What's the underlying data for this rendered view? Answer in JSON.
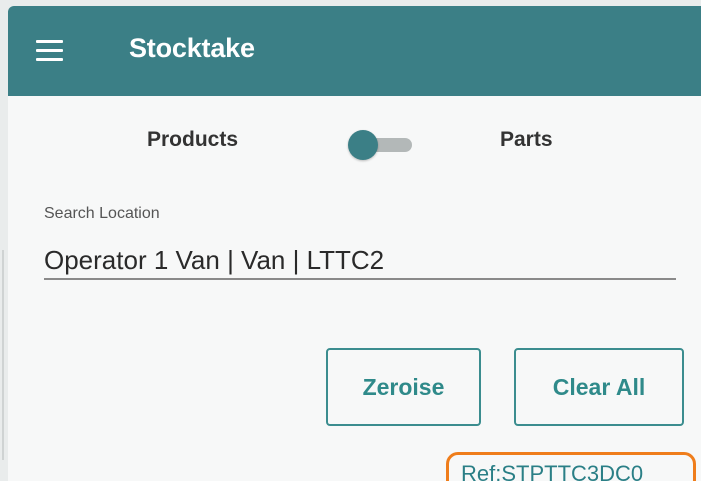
{
  "app_bar": {
    "title": "Stocktake",
    "menu_icon": "hamburger-menu-icon",
    "background_color": "#3b7f86"
  },
  "mode_toggle": {
    "left_label": "Products",
    "right_label": "Parts",
    "state": "off",
    "thumb_color": "#3b7f86"
  },
  "location_search": {
    "label": "Search Location",
    "value": "Operator 1 Van | Van | LTTC2"
  },
  "actions": {
    "zeroise_label": "Zeroise",
    "clear_all_label": "Clear All",
    "accent_color": "#2f8a8a"
  },
  "reference": {
    "text": "Ref:STPTTC3DC0",
    "highlight_color": "#ef7d1b"
  }
}
